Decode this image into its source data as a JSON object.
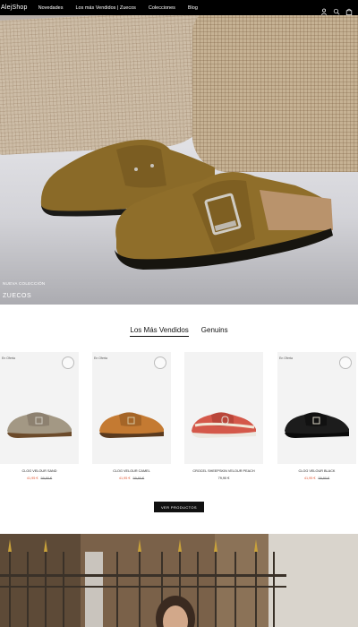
{
  "header": {
    "logo": "AlejShop",
    "nav": [
      "Novedades",
      "Los más Vendidos | Zuecos",
      "Colecciones",
      "Blog"
    ],
    "icons": [
      "user-icon",
      "search-icon",
      "bag-icon"
    ]
  },
  "hero": {
    "subtitle": "NUEVA COLECCIÓN",
    "title": "ZUECOS"
  },
  "tabs": {
    "items": [
      "Los Más Vendidos",
      "Genuins"
    ],
    "active": "Los Más Vendidos"
  },
  "products": [
    {
      "tag": "En Oferta",
      "name": "CLOG VELOUR SAND",
      "price": "41,95 €",
      "old_price": "59,90 €",
      "shoe_color": "#a39884",
      "strap_color": "#8d8170"
    },
    {
      "tag": "En Oferta",
      "name": "CLOG VELOUR CAMEL",
      "price": "41,95 €",
      "old_price": "59,90 €",
      "shoe_color": "#c47a32",
      "strap_color": "#a56527"
    },
    {
      "tag": "",
      "name": "CROCEL SHEEPSKIN VELOUR PEACH",
      "price": "79,90 €",
      "old_price": "",
      "shoe_color": "#d4584a",
      "strap_color": "#b9463a"
    },
    {
      "tag": "En Oferta",
      "name": "CLOG VELOUR BLACK",
      "price": "41,95 €",
      "old_price": "59,90 €",
      "shoe_color": "#1c1c1c",
      "strap_color": "#111111"
    }
  ],
  "cta": {
    "label": "VER PRODUCTOS"
  },
  "colors": {
    "sale": "#e0532e",
    "header_bg": "#000000"
  }
}
